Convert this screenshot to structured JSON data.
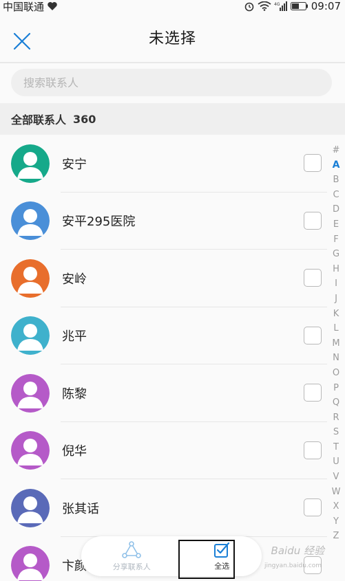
{
  "status_bar": {
    "carrier": "中国联通",
    "time": "09:07",
    "network": "4G"
  },
  "header": {
    "title": "未选择",
    "close_icon": "close-icon"
  },
  "search": {
    "placeholder": "搜索联系人",
    "value": ""
  },
  "section": {
    "label": "全部联系人",
    "count": "360"
  },
  "contacts": [
    {
      "name": "安宁",
      "avatar_color": "#16a98a"
    },
    {
      "name": "安平295医院",
      "avatar_color": "#4a8fd8"
    },
    {
      "name": "安岭",
      "avatar_color": "#e86e2c"
    },
    {
      "name": "兆平",
      "avatar_color": "#3fb1cc"
    },
    {
      "name": "陈黎",
      "avatar_color": "#b55ac8"
    },
    {
      "name": "倪华",
      "avatar_color": "#b55ac8"
    },
    {
      "name": "张其话",
      "avatar_color": "#5a6ab8"
    },
    {
      "name": "卞颜",
      "avatar_color": "#b55ac8"
    }
  ],
  "alpha_index": [
    "#",
    "A",
    "B",
    "C",
    "D",
    "E",
    "F",
    "G",
    "H",
    "I",
    "J",
    "K",
    "L",
    "M",
    "N",
    "O",
    "P",
    "Q",
    "R",
    "S",
    "T",
    "U",
    "V",
    "W",
    "X",
    "Y",
    "Z"
  ],
  "alpha_active": "A",
  "bottom_bar": {
    "share_label": "分享联系人",
    "select_all_label": "全选"
  },
  "watermark": {
    "text": "Baidu 经验",
    "sub": "jingyan.baidu.com"
  },
  "colors": {
    "accent": "#1a7fd6",
    "close": "#1a7fd6"
  }
}
